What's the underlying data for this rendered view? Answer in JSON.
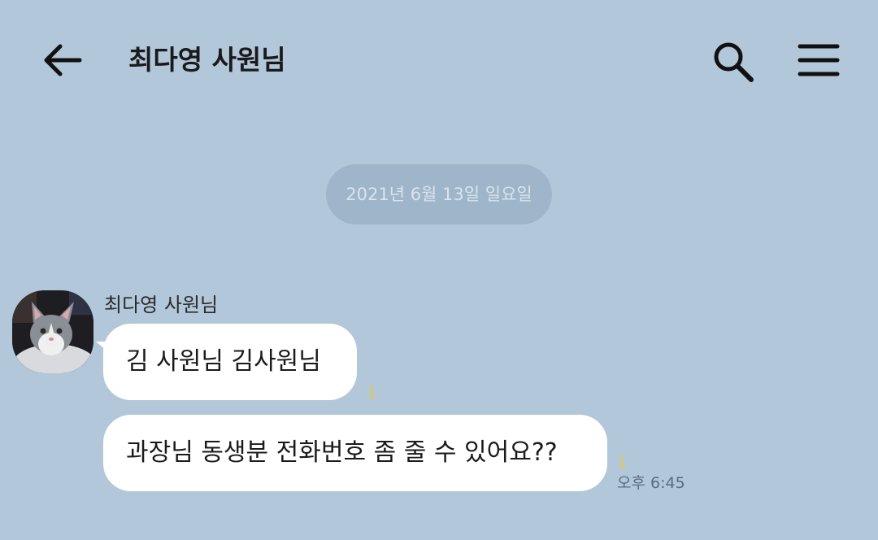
{
  "header": {
    "title": "최다영 사원님",
    "back_icon": "arrow-left-icon",
    "search_icon": "search-icon",
    "menu_icon": "hamburger-menu-icon"
  },
  "date_divider": "2021년 6월 13일 일요일",
  "messages": [
    {
      "sender": "최다영 사원님",
      "text": "김 사원님 김사원님",
      "unread": "1"
    },
    {
      "text": "과장님 동생분 전화번호 좀 줄 수 있어요??",
      "unread": "1",
      "time": "오후 6:45"
    }
  ],
  "colors": {
    "background": "#b2c7da",
    "bubble": "#ffffff",
    "date_pill": "#9fb5c9",
    "unread": "#e4c84b"
  }
}
